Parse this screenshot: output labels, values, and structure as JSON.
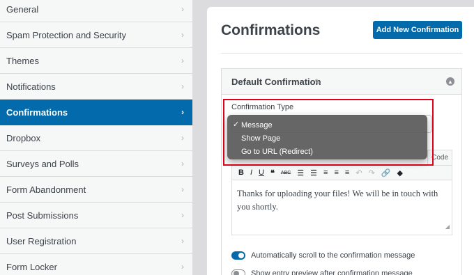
{
  "sidebar": {
    "items": [
      {
        "label": "General"
      },
      {
        "label": "Spam Protection and Security"
      },
      {
        "label": "Themes"
      },
      {
        "label": "Notifications"
      },
      {
        "label": "Confirmations"
      },
      {
        "label": "Dropbox"
      },
      {
        "label": "Surveys and Polls"
      },
      {
        "label": "Form Abandonment"
      },
      {
        "label": "Post Submissions"
      },
      {
        "label": "User Registration"
      },
      {
        "label": "Form Locker"
      }
    ],
    "active": "Confirmations"
  },
  "main": {
    "title": "Confirmations",
    "add_button": "Add New Confirmation",
    "confirmation": {
      "title": "Default Confirmation",
      "type_label": "Confirmation Type",
      "type_options": [
        "Message",
        "Show Page",
        "Go to URL (Redirect)"
      ],
      "selected_type": "Message",
      "editor": {
        "code_tab": "Code",
        "message": "Thanks for uploading your files! We will be in touch with you shortly."
      },
      "toggles": [
        {
          "label": "Automatically scroll to the confirmation message",
          "on": true
        },
        {
          "label": "Show entry preview after confirmation message",
          "on": false
        }
      ]
    }
  },
  "colors": {
    "accent": "#036aab",
    "highlight": "#e0001b"
  }
}
